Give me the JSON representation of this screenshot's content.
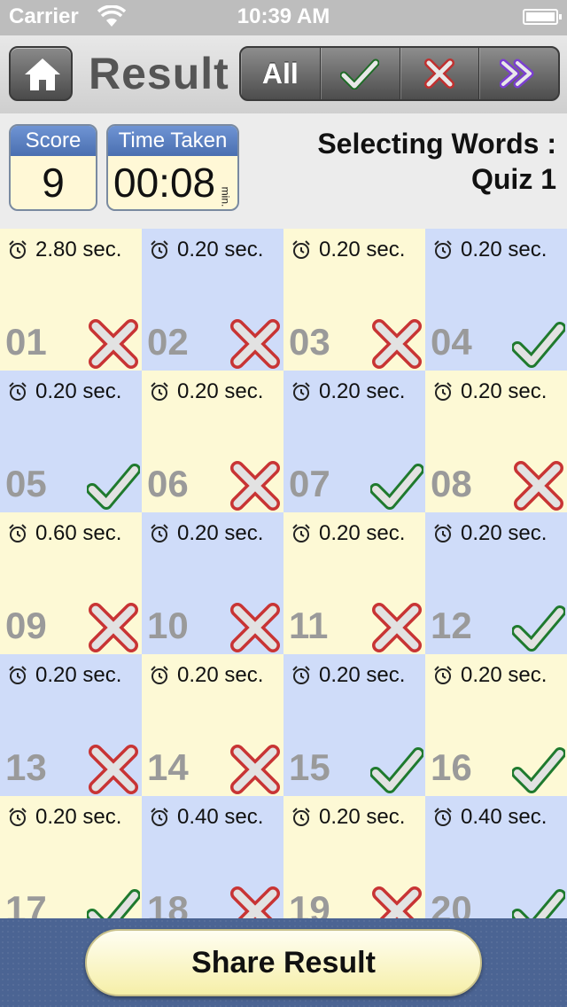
{
  "status_bar": {
    "carrier": "Carrier",
    "time": "10:39 AM"
  },
  "toolbar": {
    "title": "Result",
    "filter_all_label": "All"
  },
  "info": {
    "score_label": "Score",
    "score_value": "9",
    "time_label": "Time Taken",
    "time_value": "00:08",
    "time_unit": "min.",
    "quiz_line1": "Selecting Words :",
    "quiz_line2": "Quiz 1"
  },
  "questions": [
    {
      "num": "01",
      "time": "2.80 sec.",
      "correct": false
    },
    {
      "num": "02",
      "time": "0.20 sec.",
      "correct": false
    },
    {
      "num": "03",
      "time": "0.20 sec.",
      "correct": false
    },
    {
      "num": "04",
      "time": "0.20 sec.",
      "correct": true
    },
    {
      "num": "05",
      "time": "0.20 sec.",
      "correct": true
    },
    {
      "num": "06",
      "time": "0.20 sec.",
      "correct": false
    },
    {
      "num": "07",
      "time": "0.20 sec.",
      "correct": true
    },
    {
      "num": "08",
      "time": "0.20 sec.",
      "correct": false
    },
    {
      "num": "09",
      "time": "0.60 sec.",
      "correct": false
    },
    {
      "num": "10",
      "time": "0.20 sec.",
      "correct": false
    },
    {
      "num": "11",
      "time": "0.20 sec.",
      "correct": false
    },
    {
      "num": "12",
      "time": "0.20 sec.",
      "correct": true
    },
    {
      "num": "13",
      "time": "0.20 sec.",
      "correct": false
    },
    {
      "num": "14",
      "time": "0.20 sec.",
      "correct": false
    },
    {
      "num": "15",
      "time": "0.20 sec.",
      "correct": true
    },
    {
      "num": "16",
      "time": "0.20 sec.",
      "correct": true
    },
    {
      "num": "17",
      "time": "0.20 sec.",
      "correct": true
    },
    {
      "num": "18",
      "time": "0.40 sec.",
      "correct": false
    },
    {
      "num": "19",
      "time": "0.20 sec.",
      "correct": false
    },
    {
      "num": "20",
      "time": "0.40 sec.",
      "correct": true
    }
  ],
  "share_label": "Share Result",
  "colors": {
    "cell_yellow": "#fdf9d5",
    "cell_blue": "#cfdcf9",
    "correct_green": "#2f9a3c",
    "wrong_red": "#d23a3a",
    "next_purple": "#7b3fd0",
    "bottom_bar": "#4b6493"
  }
}
